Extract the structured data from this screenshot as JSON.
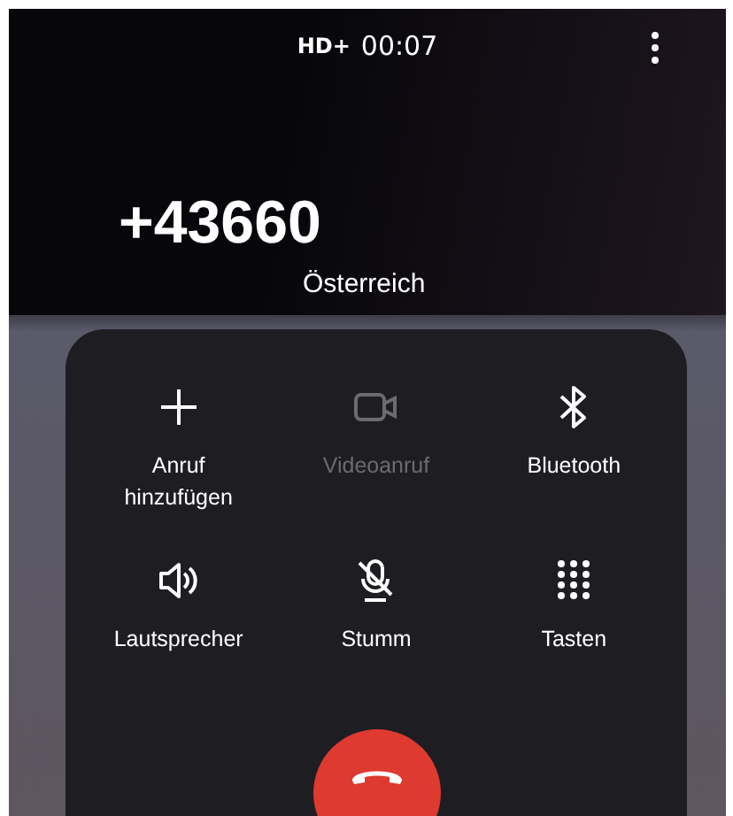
{
  "status": {
    "hd_badge": "HD+",
    "duration": "00:07"
  },
  "caller": {
    "number": "+43660",
    "location": "Österreich"
  },
  "actions": [
    {
      "kind": "add",
      "label": "Anruf\nhinzufügen",
      "disabled": false
    },
    {
      "kind": "video",
      "label": "Videoanruf",
      "disabled": true
    },
    {
      "kind": "bluetooth",
      "label": "Bluetooth",
      "disabled": false
    },
    {
      "kind": "speaker",
      "label": "Lautsprecher",
      "disabled": false
    },
    {
      "kind": "mute",
      "label": "Stumm",
      "disabled": false
    },
    {
      "kind": "keypad",
      "label": "Tasten",
      "disabled": false
    }
  ]
}
